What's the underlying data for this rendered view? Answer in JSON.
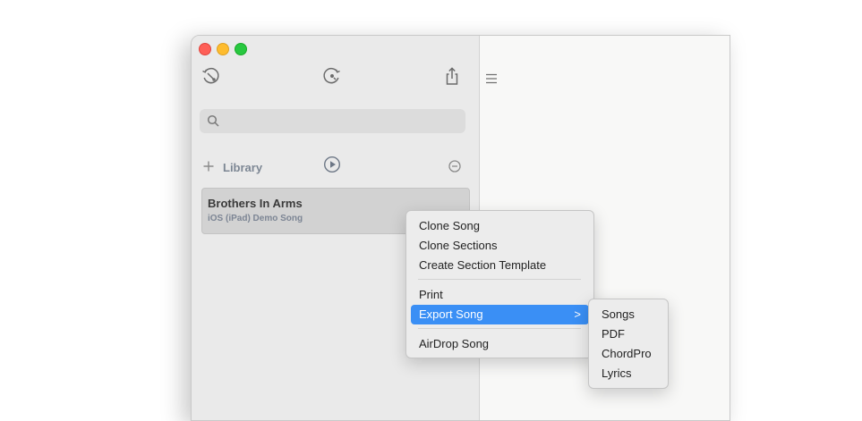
{
  "search": {
    "value": "",
    "placeholder": ""
  },
  "library": {
    "label": "Library"
  },
  "song": {
    "title": "Brothers In Arms",
    "subtitle": "iOS (iPad) Demo Song"
  },
  "context_menu": {
    "items": [
      {
        "label": "Clone Song"
      },
      {
        "label": "Clone Sections"
      },
      {
        "label": "Create Section Template"
      },
      {
        "label": "Print"
      },
      {
        "label": "Export Song",
        "has_submenu": true,
        "submenu_icon": ">"
      },
      {
        "label": "AirDrop Song"
      }
    ]
  },
  "export_submenu": {
    "items": [
      {
        "label": "Songs"
      },
      {
        "label": "PDF"
      },
      {
        "label": "ChordPro"
      },
      {
        "label": "Lyrics"
      }
    ]
  },
  "icons": {
    "traffic": [
      "close-button",
      "minimize-button",
      "zoom-button"
    ],
    "toolbar": [
      "rewind-clock-icon",
      "forward-clock-icon",
      "share-icon",
      "list-icon"
    ],
    "library": [
      "plus-icon",
      "play-circle-icon",
      "minus-circle-icon"
    ]
  },
  "colors": {
    "accent": "#3a8ff5",
    "sidebar_bg": "#eaeaea",
    "selected_item_bg": "#d2d2d2",
    "subtitle_color": "#7c8594"
  }
}
